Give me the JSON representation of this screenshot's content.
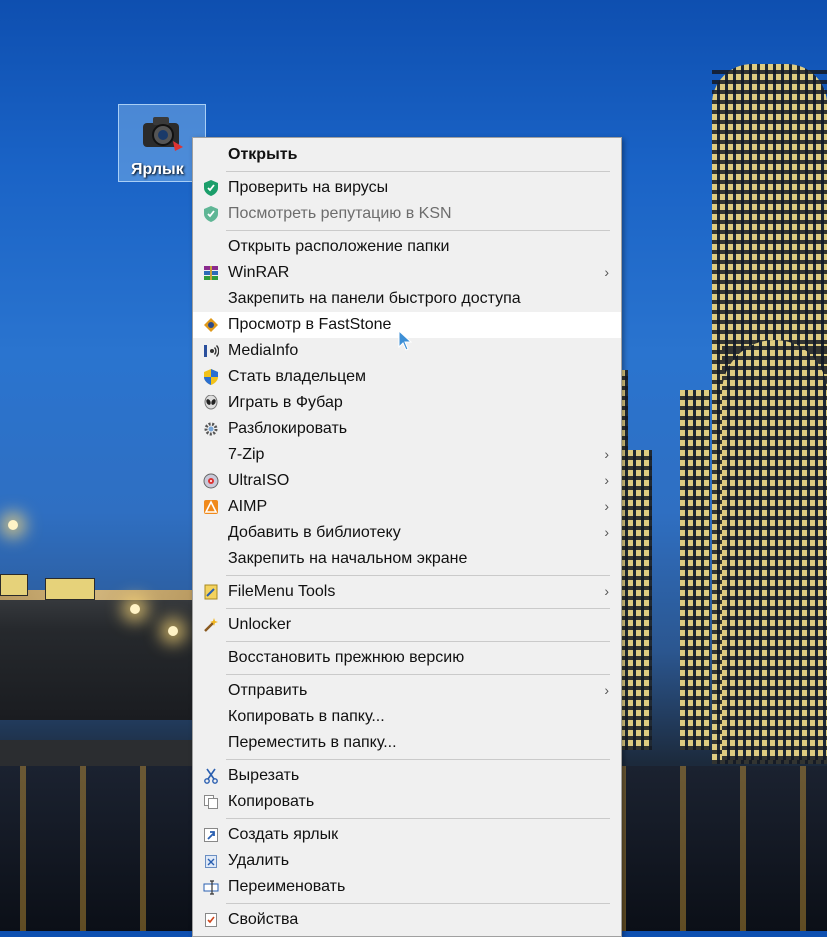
{
  "desktop": {
    "shortcut_label": "Ярлык"
  },
  "context_menu": {
    "items": [
      {
        "label": "Открыть",
        "icon": ""
      },
      {
        "label": "Проверить на вирусы",
        "icon": "kaspersky-shield-icon"
      },
      {
        "label": "Посмотреть репутацию в KSN",
        "icon": "kaspersky-shield-icon"
      },
      {
        "label": "Открыть расположение папки",
        "icon": ""
      },
      {
        "label": "WinRAR",
        "icon": "winrar-icon"
      },
      {
        "label": "Закрепить на панели быстрого доступа",
        "icon": ""
      },
      {
        "label": "Просмотр в FastStone",
        "icon": "faststone-icon"
      },
      {
        "label": "MediaInfo",
        "icon": "mediainfo-icon"
      },
      {
        "label": "Стать владельцем",
        "icon": "uac-shield-icon"
      },
      {
        "label": "Играть в Фубар",
        "icon": "foobar-alien-icon"
      },
      {
        "label": "Разблокировать",
        "icon": "unblock-gear-icon"
      },
      {
        "label": "7-Zip",
        "icon": ""
      },
      {
        "label": "UltraISO",
        "icon": "ultraiso-icon"
      },
      {
        "label": "AIMP",
        "icon": "aimp-icon"
      },
      {
        "label": "Добавить в библиотеку",
        "icon": ""
      },
      {
        "label": "Закрепить на начальном экране",
        "icon": ""
      },
      {
        "label": "FileMenu Tools",
        "icon": "filemenu-tools-icon"
      },
      {
        "label": "Unlocker",
        "icon": "unlocker-wand-icon"
      },
      {
        "label": "Восстановить прежнюю версию",
        "icon": ""
      },
      {
        "label": "Отправить",
        "icon": ""
      },
      {
        "label": "Копировать в папку...",
        "icon": ""
      },
      {
        "label": "Переместить в папку...",
        "icon": ""
      },
      {
        "label": "Вырезать",
        "icon": "scissors-icon"
      },
      {
        "label": "Копировать",
        "icon": "copy-icon"
      },
      {
        "label": "Создать ярлык",
        "icon": "shortcut-icon"
      },
      {
        "label": "Удалить",
        "icon": "delete-icon"
      },
      {
        "label": "Переименовать",
        "icon": "rename-icon"
      },
      {
        "label": "Свойства",
        "icon": "properties-icon"
      }
    ]
  },
  "colors": {
    "menu_bg": "#f0f0f0",
    "menu_hover": "#ffffff",
    "kaspersky_green": "#1b9e6a"
  }
}
